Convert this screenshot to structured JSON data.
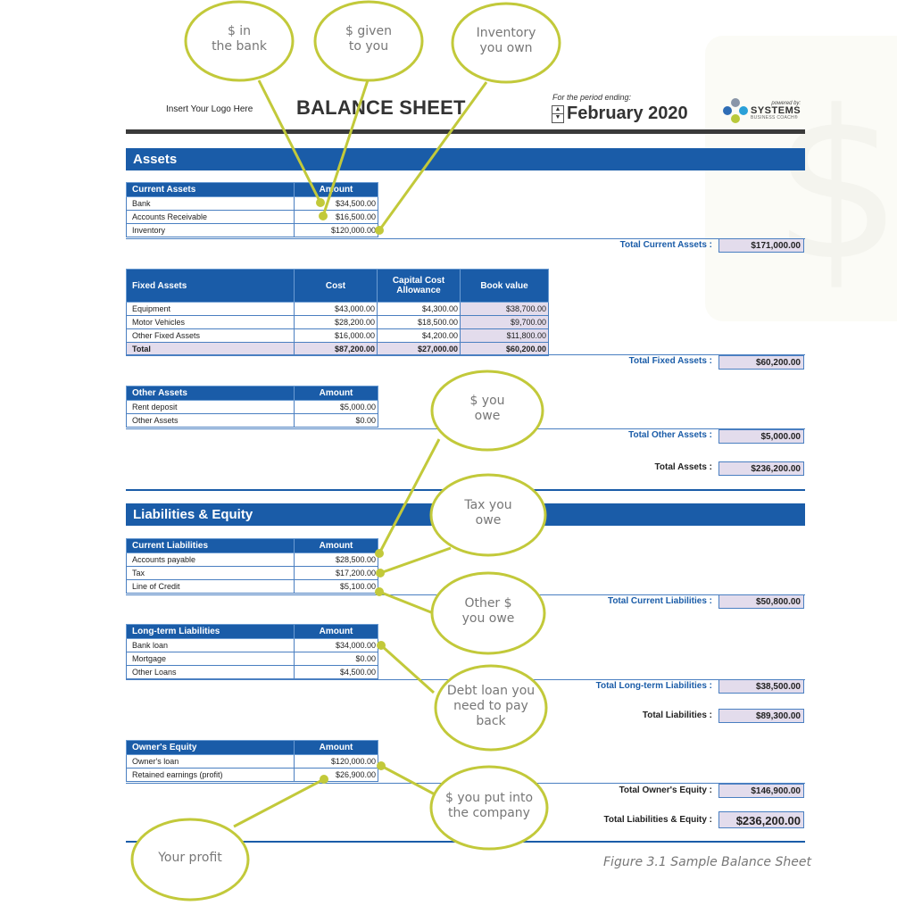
{
  "header": {
    "logo_placeholder": "Insert Your Logo Here",
    "title": "BALANCE SHEET",
    "period_label": "For the period ending:",
    "period_value": "February 2020",
    "spinner_up": "▲",
    "spinner_down": "▼",
    "brand_powered_by": "powered by:",
    "brand_name": "SYSTEMS",
    "brand_sub": "BUSINESS COACH®"
  },
  "assets": {
    "section_title": "Assets",
    "current": {
      "header": "Current Assets",
      "amount_header": "Amount",
      "rows": [
        {
          "label": "Bank",
          "amount": "$34,500.00"
        },
        {
          "label": "Accounts Receivable",
          "amount": "$16,500.00"
        },
        {
          "label": "Inventory",
          "amount": "$120,000.00"
        }
      ],
      "total_label": "Total Current Assets :",
      "total_value": "$171,000.00"
    },
    "fixed": {
      "header": "Fixed Assets",
      "cost_header": "Cost",
      "cca_header": "Capital Cost Allowance",
      "book_header": "Book value",
      "rows": [
        {
          "label": "Equipment",
          "cost": "$43,000.00",
          "cca": "$4,300.00",
          "book": "$38,700.00"
        },
        {
          "label": "Motor Vehicles",
          "cost": "$28,200.00",
          "cca": "$18,500.00",
          "book": "$9,700.00"
        },
        {
          "label": "Other Fixed Assets",
          "cost": "$16,000.00",
          "cca": "$4,200.00",
          "book": "$11,800.00"
        }
      ],
      "totals_row": {
        "label": "Total",
        "cost": "$87,200.00",
        "cca": "$27,000.00",
        "book": "$60,200.00"
      },
      "total_label": "Total Fixed Assets :",
      "total_value": "$60,200.00"
    },
    "other": {
      "header": "Other Assets",
      "amount_header": "Amount",
      "rows": [
        {
          "label": "Rent deposit",
          "amount": "$5,000.00"
        },
        {
          "label": "Other Assets",
          "amount": "$0.00"
        }
      ],
      "total_label": "Total Other Assets :",
      "total_value": "$5,000.00"
    },
    "grand_total_label": "Total Assets :",
    "grand_total_value": "$236,200.00"
  },
  "liabilities": {
    "section_title": "Liabilities & Equity",
    "current": {
      "header": "Current Liabilities",
      "amount_header": "Amount",
      "rows": [
        {
          "label": "Accounts payable",
          "amount": "$28,500.00"
        },
        {
          "label": "Tax",
          "amount": "$17,200.00"
        },
        {
          "label": "Line of Credit",
          "amount": "$5,100.00"
        }
      ],
      "total_label": "Total Current Liabilities :",
      "total_value": "$50,800.00"
    },
    "longterm": {
      "header": "Long-term Liabilities",
      "amount_header": "Amount",
      "rows": [
        {
          "label": "Bank loan",
          "amount": "$34,000.00"
        },
        {
          "label": "Mortgage",
          "amount": "$0.00"
        },
        {
          "label": "Other Loans",
          "amount": "$4,500.00"
        }
      ],
      "total_label": "Total Long-term Liabilities :",
      "total_value": "$38,500.00"
    },
    "total_liabilities_label": "Total Liabilities :",
    "total_liabilities_value": "$89,300.00",
    "equity": {
      "header": "Owner's Equity",
      "amount_header": "Amount",
      "rows": [
        {
          "label": "Owner's loan",
          "amount": "$120,000.00"
        },
        {
          "label": "Retained earnings (profit)",
          "amount": "$26,900.00"
        }
      ],
      "total_label": "Total Owner's Equity :",
      "total_value": "$146,900.00"
    },
    "grand_total_label": "Total Liabilities & Equity :",
    "grand_total_value": "$236,200.00"
  },
  "callouts": [
    {
      "id": "bank",
      "text": "$ in\nthe bank"
    },
    {
      "id": "receivable",
      "text": "$ given\nto you"
    },
    {
      "id": "inventory",
      "text": "Inventory\nyou own"
    },
    {
      "id": "payable",
      "text": "$ you\nowe"
    },
    {
      "id": "tax",
      "text": "Tax you\nowe"
    },
    {
      "id": "credit",
      "text": "Other $\nyou owe"
    },
    {
      "id": "loan",
      "text": "Debt loan you\nneed to pay\nback"
    },
    {
      "id": "owner-loan",
      "text": "$ you put into\nthe company"
    },
    {
      "id": "profit",
      "text": "Your profit"
    }
  ],
  "colors": {
    "section_blue": "#1a5ca8",
    "total_fill": "#e3dcec",
    "callout_green": "#c2c93a",
    "rule_dark": "#3a3a3a"
  },
  "caption": "Figure 3.1 Sample Balance Sheet"
}
